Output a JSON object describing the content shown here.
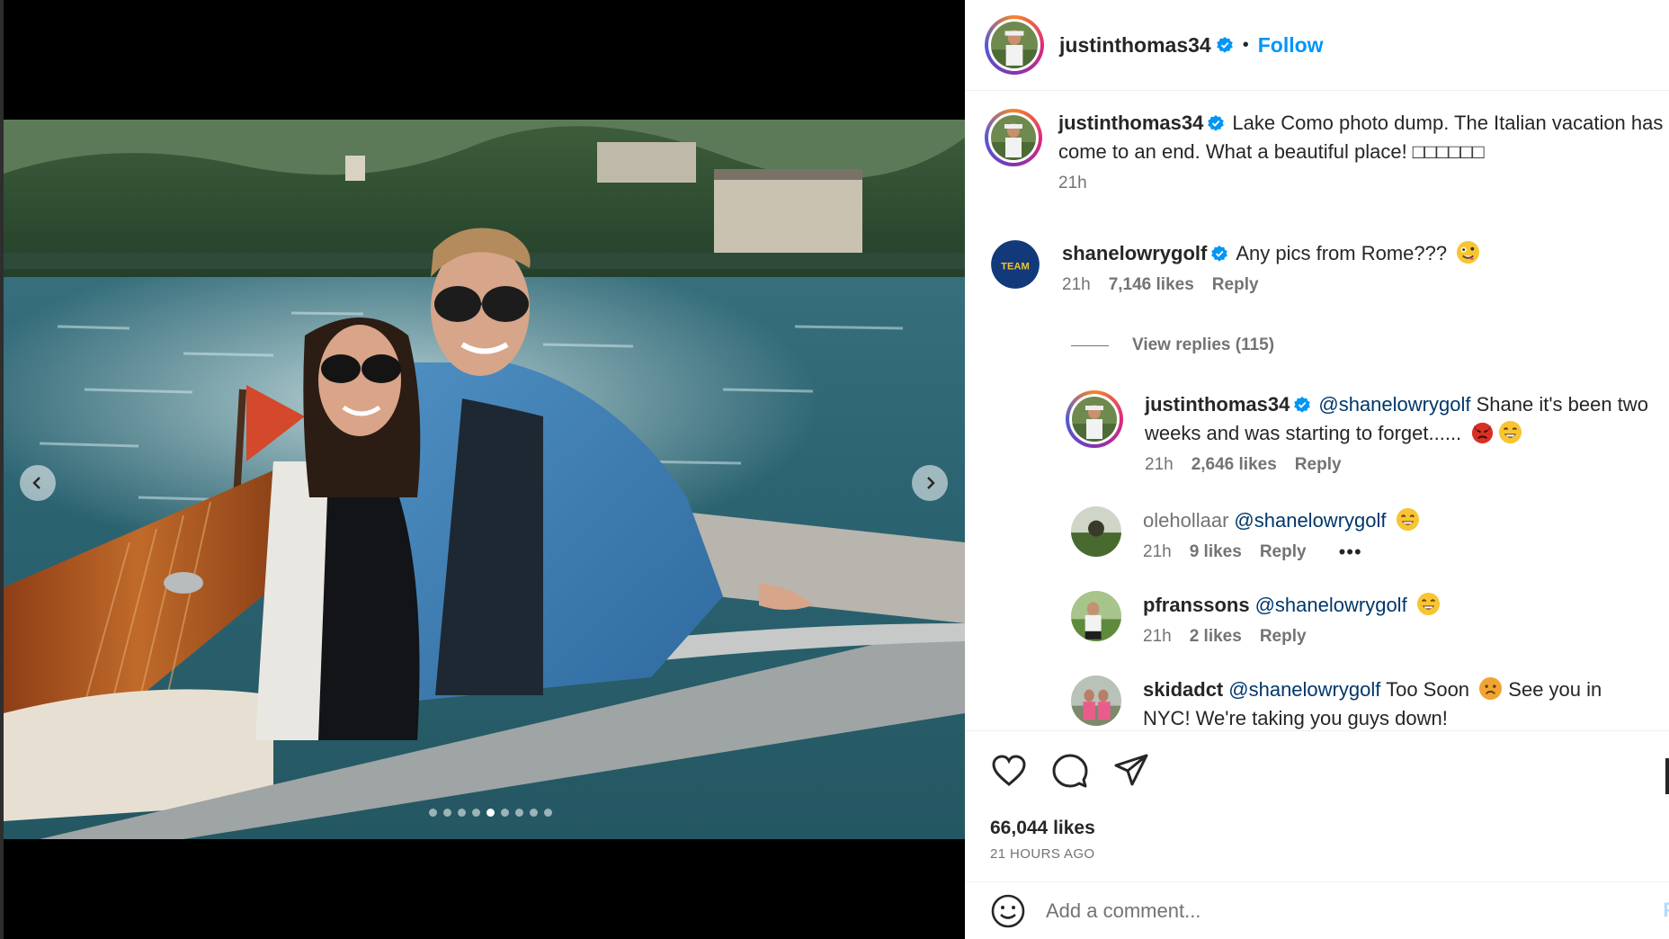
{
  "post": {
    "author": "justinthomas34",
    "follow_label": "Follow",
    "separator": "•",
    "image_count": 9,
    "active_image_index": 4
  },
  "caption": {
    "username": "justinthomas34",
    "text": "Lake Como photo dump. The Italian vacation has come to an end. What a beautiful place! □□□□□□",
    "time": "21h"
  },
  "comments": [
    {
      "username": "shanelowrygolf",
      "verified": true,
      "text": "Any pics from Rome???",
      "emoji": "zany-face",
      "time": "21h",
      "likes": "7,146 likes",
      "reply_label": "Reply"
    },
    {
      "username": "justinthomas34",
      "verified": true,
      "mention": "@shanelowrygolf",
      "text": "Shane it's been two weeks and was starting to forget......",
      "emoji": [
        "angry-devil-face",
        "laughing-face"
      ],
      "time": "21h",
      "likes": "2,646 likes",
      "reply_label": "Reply"
    },
    {
      "username": "olehollaar",
      "mention": "@shanelowrygolf",
      "emoji": "laughing-face",
      "time": "21h",
      "likes": "9 likes",
      "reply_label": "Reply",
      "more": "•••"
    },
    {
      "username": "pfranssons",
      "mention": "@shanelowrygolf",
      "emoji": "laughing-face",
      "time": "21h",
      "likes": "2 likes",
      "reply_label": "Reply"
    },
    {
      "username": "skidadct",
      "mention": "@shanelowrygolf",
      "text_before_emoji": "Too Soon",
      "emoji": "sad-face",
      "text_after_emoji": "See you in NYC! We're taking you guys down!"
    }
  ],
  "view_replies": "View replies (115)",
  "footer": {
    "likes": "66,044 likes",
    "time_ago": "21 HOURS AGO"
  },
  "add_comment": {
    "placeholder": "Add a comment...",
    "post_label": "P"
  },
  "colors": {
    "link_blue": "#0095f6",
    "mention_blue": "#00376b",
    "secondary_text": "#737373",
    "verified_blue": "#0095f6"
  }
}
